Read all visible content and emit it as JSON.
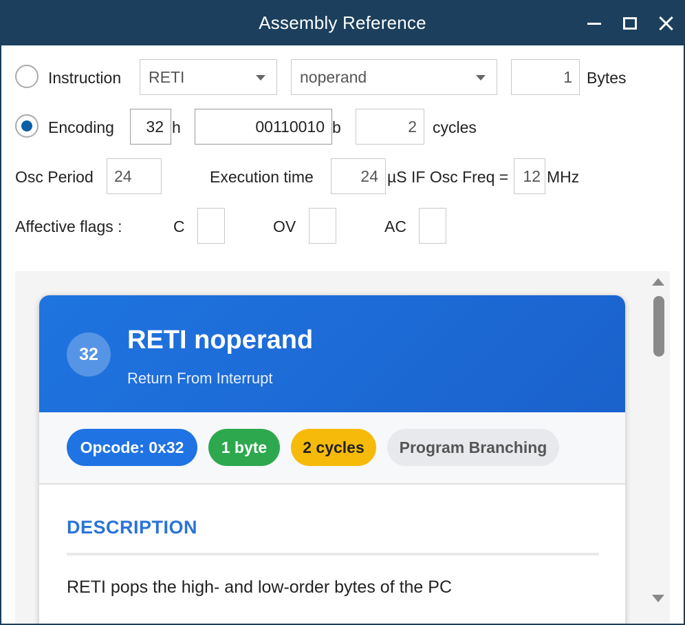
{
  "window": {
    "title": "Assembly Reference"
  },
  "form": {
    "instruction_label": "Instruction",
    "mnemonic": "RETI",
    "operand": "noperand",
    "bytes_value": "1",
    "bytes_label": "Bytes",
    "encoding_label": "Encoding",
    "hex_value": "32",
    "hex_suffix": "h",
    "bin_value": "00110010",
    "bin_suffix": "b",
    "cycles_value": "2",
    "cycles_label": "cycles",
    "osc_period_label": "Osc Period",
    "osc_period_value": "24",
    "exec_time_label": "Execution time",
    "exec_time_value": "24",
    "exec_unit_text": "µS IF Osc Freq =",
    "osc_freq_value": "12",
    "osc_freq_unit": "MHz",
    "flags_label": "Affective flags :",
    "flag_c_label": "C",
    "flag_c_value": "",
    "flag_ov_label": "OV",
    "flag_ov_value": "",
    "flag_ac_label": "AC",
    "flag_ac_value": "",
    "selected_mode": "encoding"
  },
  "card": {
    "opcode_badge": "32",
    "title": "RETI noperand",
    "subtitle": "Return From Interrupt",
    "pills": {
      "opcode": "Opcode: 0x32",
      "bytes": "1 byte",
      "cycles": "2 cycles",
      "group": "Program Branching"
    },
    "section_title": "DESCRIPTION",
    "description": "RETI pops the high- and low-order bytes of the PC"
  },
  "colors": {
    "titlebar": "#1b3f5c",
    "header_blue": "#1f74e0",
    "pill_blue": "#1f73e3",
    "pill_green": "#2ea84f",
    "pill_yellow": "#f6bb0a",
    "pill_grey": "#e8e9ec",
    "section_title": "#2a73d8",
    "radio_selected": "#0b5fa5"
  }
}
